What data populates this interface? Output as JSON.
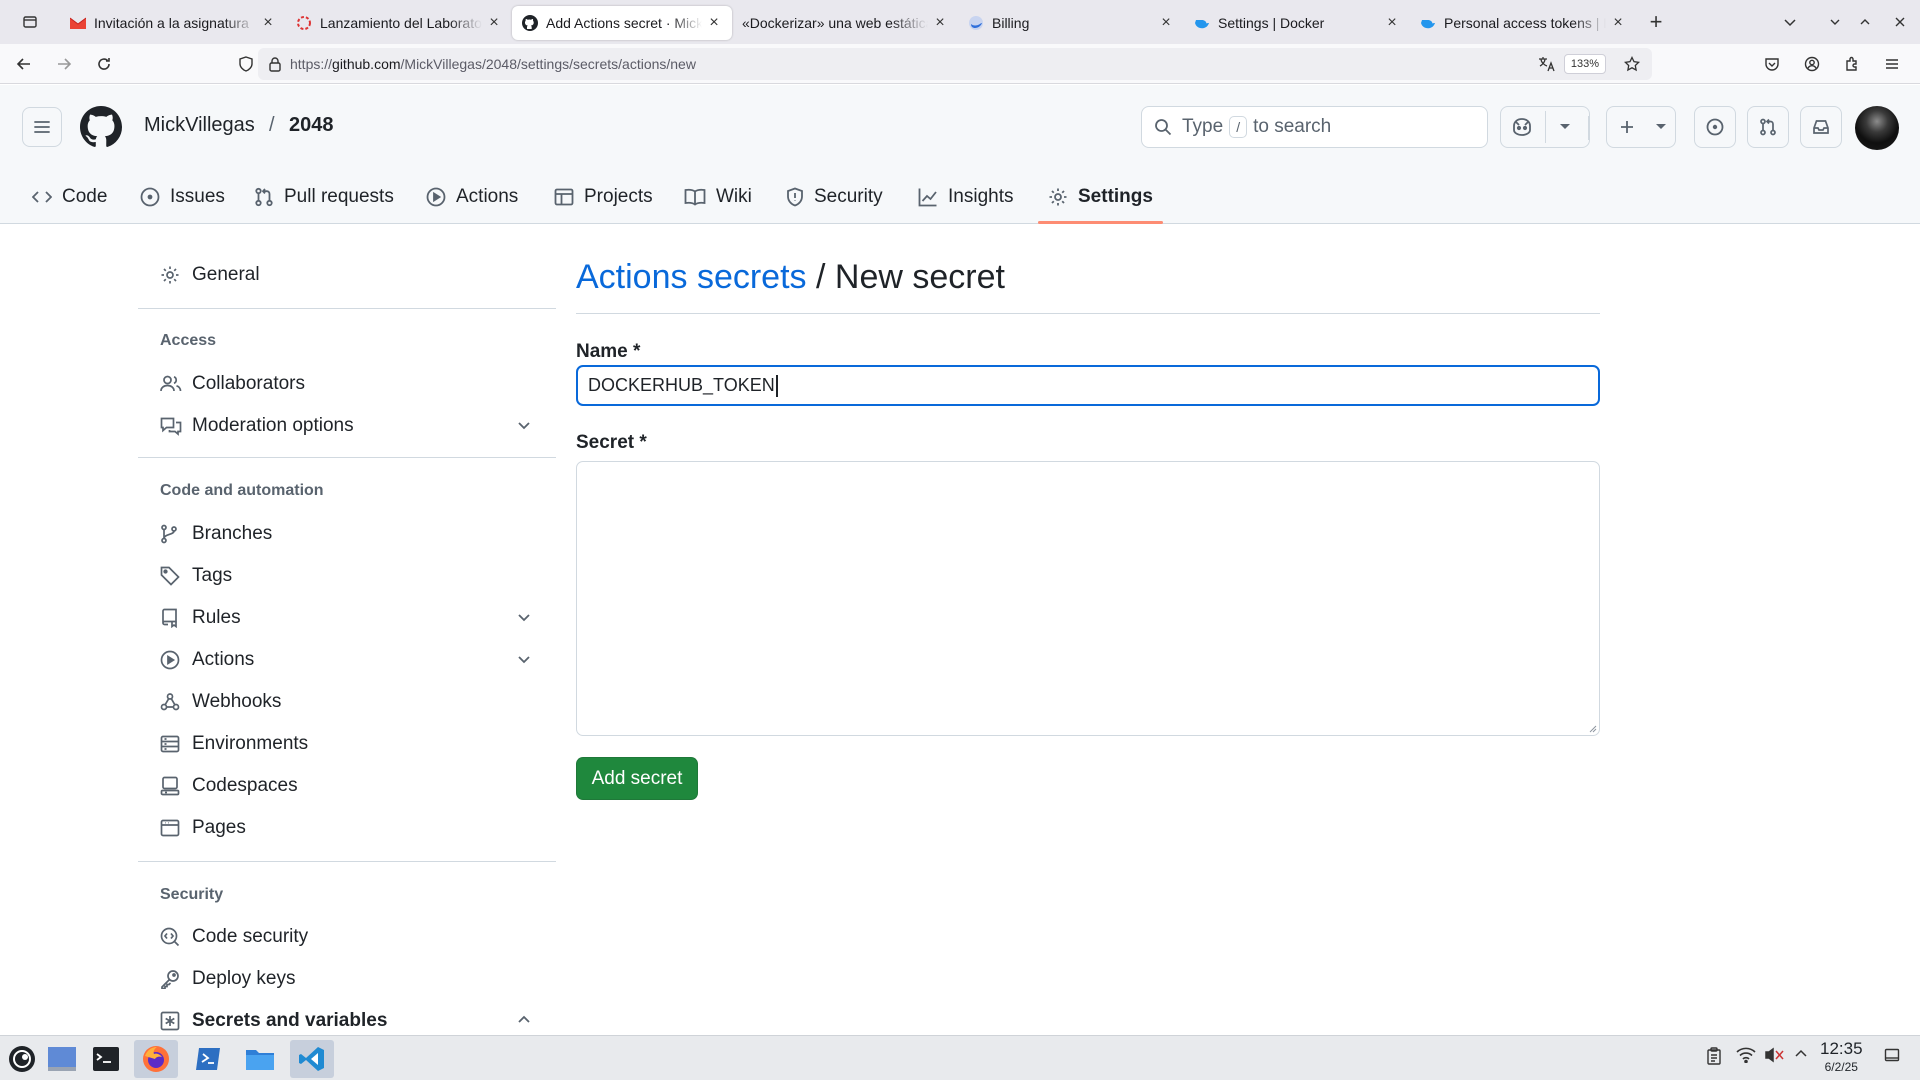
{
  "browser": {
    "tabs": [
      {
        "title": "Invitación a la asignatura",
        "favicon": "gmail-icon",
        "active": false
      },
      {
        "title": "Lanzamiento del Laboratorio",
        "favicon": "loading-icon",
        "active": false
      },
      {
        "title": "Add Actions secret · MickVillegas",
        "favicon": "github-icon",
        "active": true
      },
      {
        "title": "«Dockerizar» una web estática",
        "favicon": "none",
        "active": false
      },
      {
        "title": "Billing",
        "favicon": "docker-icon",
        "active": false
      },
      {
        "title": "Settings | Docker",
        "favicon": "docker-icon",
        "active": false
      },
      {
        "title": "Personal access tokens | Docker",
        "favicon": "docker-icon",
        "active": false
      }
    ],
    "url_prefix": "https://",
    "url_host": "github.com",
    "url_path": "/MickVillegas/2048/settings/secrets/actions/new",
    "zoom": "133%"
  },
  "github": {
    "owner": "MickVillegas",
    "separator": "/",
    "repo": "2048",
    "search_prefix": "Type",
    "search_key": "/",
    "search_suffix": "to search",
    "repo_tabs": [
      {
        "label": "Code",
        "icon": "code-icon"
      },
      {
        "label": "Issues",
        "icon": "issue-icon"
      },
      {
        "label": "Pull requests",
        "icon": "pull-request-icon"
      },
      {
        "label": "Actions",
        "icon": "play-icon"
      },
      {
        "label": "Projects",
        "icon": "table-icon"
      },
      {
        "label": "Wiki",
        "icon": "book-icon"
      },
      {
        "label": "Security",
        "icon": "shield-icon"
      },
      {
        "label": "Insights",
        "icon": "graph-icon"
      },
      {
        "label": "Settings",
        "icon": "gear-icon",
        "selected": true
      }
    ]
  },
  "sidebar": {
    "general": "General",
    "access_heading": "Access",
    "access_items": [
      "Collaborators",
      "Moderation options"
    ],
    "code_heading": "Code and automation",
    "code_items": [
      "Branches",
      "Tags",
      "Rules",
      "Actions",
      "Webhooks",
      "Environments",
      "Codespaces",
      "Pages"
    ],
    "security_heading": "Security",
    "security_items": [
      "Code security",
      "Deploy keys",
      "Secrets and variables"
    ]
  },
  "main": {
    "title_link": "Actions secrets",
    "title_sep": "/",
    "title_rest": "New secret",
    "name_label": "Name *",
    "name_value": "DOCKERHUB_TOKEN",
    "secret_label": "Secret *",
    "secret_value": "",
    "submit_label": "Add secret"
  },
  "taskbar": {
    "time": "12:35",
    "date": "6/2/25"
  },
  "colors": {
    "link": "#0969da",
    "primary_button": "#1f883d",
    "tab_underline": "#fd8c73"
  }
}
